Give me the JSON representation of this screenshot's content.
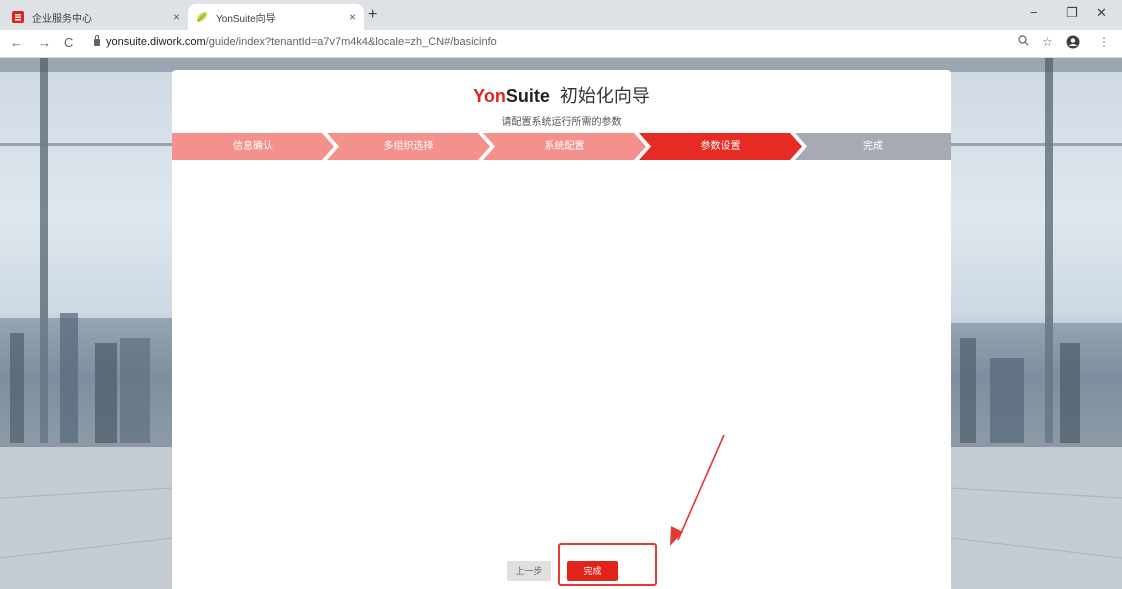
{
  "browser": {
    "tabs": [
      {
        "title": "企业服务中心",
        "icon": "enterprise-service-icon"
      },
      {
        "title": "YonSuite向导",
        "icon": "leaf-icon"
      }
    ],
    "new_tab_symbol": "+",
    "close_symbol": "×",
    "window_controls": {
      "minimize": "−",
      "restore": "❐",
      "close": "✕"
    },
    "nav": {
      "back": "←",
      "forward": "→",
      "reload": "C"
    },
    "url_host": "yonsuite.diwork.com",
    "url_path": "/guide/index?tenantId=a7v7m4k4&locale=zh_CN#/basicinfo",
    "toolbar_icons": {
      "zoom": "🔍",
      "star": "☆",
      "profile": "●",
      "menu": "⋮"
    }
  },
  "wizard": {
    "brand_yon": "Yon",
    "brand_suite": "Suite",
    "title": "初始化向导",
    "subtitle": "请配置系统运行所需的参数",
    "steps": [
      {
        "label": "信息确认",
        "state": "done"
      },
      {
        "label": "多组织选择",
        "state": "done"
      },
      {
        "label": "系统配置",
        "state": "done"
      },
      {
        "label": "参数设置",
        "state": "active"
      },
      {
        "label": "完成",
        "state": "pending"
      }
    ],
    "step_colors": {
      "done": "#f5918d",
      "active": "#e52b24",
      "pending": "#a7aab3"
    },
    "prev_button": "上一步",
    "finish_button": "完成"
  },
  "annotation": {
    "color": "#e53935"
  }
}
